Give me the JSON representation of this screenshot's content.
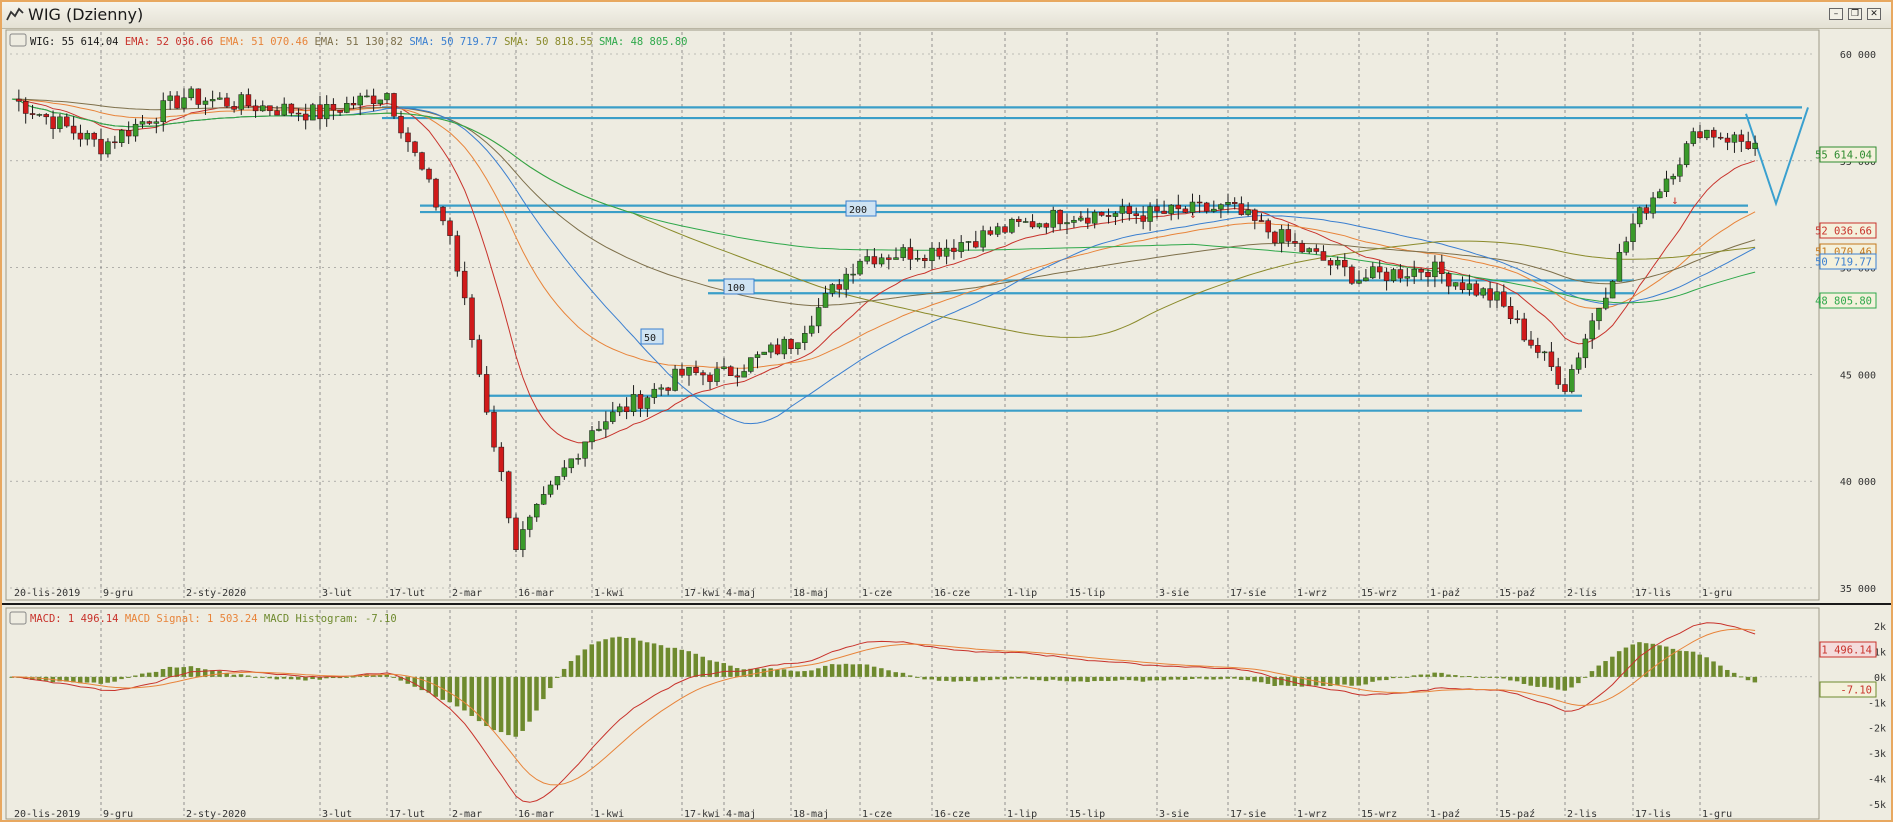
{
  "window": {
    "title": "WIG (Dzienny)",
    "buttons": [
      "minimize",
      "restore",
      "close"
    ]
  },
  "legend_main": [
    {
      "text": "WIG: 55 614.04",
      "color": "#1a1a1a"
    },
    {
      "text": "EMA: 52 036.66",
      "color": "#c8322b"
    },
    {
      "text": "EMA: 51 070.46",
      "color": "#e8843a"
    },
    {
      "text": "EMA: 51 130.82",
      "color": "#7d6f4a"
    },
    {
      "text": "SMA: 50 719.77",
      "color": "#3a7fd0"
    },
    {
      "text": "SMA: 50 818.55",
      "color": "#8a8a2a"
    },
    {
      "text": "SMA: 48 805.80",
      "color": "#2ea84a"
    }
  ],
  "legend_macd": [
    {
      "text": "MACD: 1 496.14",
      "color": "#c8322b"
    },
    {
      "text": "MACD Signal: 1 503.24",
      "color": "#e8843a"
    },
    {
      "text": "MACD Histogram: -7.10",
      "color": "#6e8a2e"
    }
  ],
  "price_axis": [
    "60 000",
    "55 000",
    "50 000",
    "45 000",
    "40 000",
    "35 000"
  ],
  "macd_axis": [
    "2k",
    "1k",
    "0k",
    "-1k",
    "-2k",
    "-3k",
    "-4k",
    "-5k"
  ],
  "date_labels": [
    "20-lis-2019",
    "9-gru",
    "2-sty-2020",
    "3-lut",
    "17-lut",
    "2-mar",
    "16-mar",
    "1-kwi",
    "17-kwi",
    "4-maj",
    "18-maj",
    "1-cze",
    "16-cze",
    "1-lip",
    "15-lip",
    "3-sie",
    "17-sie",
    "1-wrz",
    "15-wrz",
    "1-paź",
    "15-paź",
    "2-lis",
    "17-lis",
    "1-gru"
  ],
  "value_boxes": [
    {
      "text": "55 614.04",
      "color": "#2e8b2e",
      "border": "#2e8b2e",
      "bg": "#f4f1dc"
    },
    {
      "text": "52 036.66",
      "color": "#c8322b",
      "border": "#c8322b",
      "bg": "#f4f1dc"
    },
    {
      "text": "51 070.46",
      "color": "#c4781c",
      "border": "#c4781c",
      "bg": "#f4f1dc"
    },
    {
      "text": "50 719.77",
      "color": "#3a7fd0",
      "border": "#3a7fd0",
      "bg": "#f4f1dc"
    },
    {
      "text": "48 805.80",
      "color": "#2ea84a",
      "border": "#2ea84a",
      "bg": "#f4f1dc"
    },
    {
      "text": "1 496.14",
      "color": "#c8322b",
      "border": "#c8322b",
      "bg": "#f4dcdc"
    },
    {
      "text": "-7.10",
      "color": "#c8322b",
      "border": "#6e8a2e",
      "bg": "#f4f1dc"
    }
  ],
  "ma_tags": [
    "200",
    "100",
    "50"
  ],
  "chart_data": [
    {
      "type": "candlestick",
      "title": "WIG (Dzienny)",
      "ylim": [
        35000,
        60000
      ],
      "grid": true,
      "approx_close_path": [
        {
          "date": "20-lis-2019",
          "close": 57900
        },
        {
          "date": "9-gru",
          "close": 55700
        },
        {
          "date": "2-sty-2020",
          "close": 58000
        },
        {
          "date": "3-lut",
          "close": 57200
        },
        {
          "date": "17-lut",
          "close": 58200
        },
        {
          "date": "2-mar",
          "close": 51500
        },
        {
          "date": "16-mar",
          "close": 37000
        },
        {
          "date": "1-kwi",
          "close": 42500
        },
        {
          "date": "17-kwi",
          "close": 45000
        },
        {
          "date": "4-maj",
          "close": 45000
        },
        {
          "date": "18-maj",
          "close": 46500
        },
        {
          "date": "1-cze",
          "close": 50500
        },
        {
          "date": "16-cze",
          "close": 50800
        },
        {
          "date": "1-lip",
          "close": 51800
        },
        {
          "date": "15-lip",
          "close": 52500
        },
        {
          "date": "3-sie",
          "close": 52500
        },
        {
          "date": "17-sie",
          "close": 52800
        },
        {
          "date": "1-wrz",
          "close": 51000
        },
        {
          "date": "15-wrz",
          "close": 49500
        },
        {
          "date": "1-paź",
          "close": 50000
        },
        {
          "date": "15-paź",
          "close": 48500
        },
        {
          "date": "2-lis",
          "close": 44500
        },
        {
          "date": "17-lis",
          "close": 52000
        },
        {
          "date": "1-gru",
          "close": 56500
        }
      ],
      "indicators": [
        {
          "name": "EMA",
          "last": 52036.66
        },
        {
          "name": "EMA",
          "last": 51070.46
        },
        {
          "name": "EMA",
          "last": 51130.82
        },
        {
          "name": "SMA",
          "last": 50719.77
        },
        {
          "name": "SMA",
          "last": 50818.55
        },
        {
          "name": "SMA",
          "last": 48805.8
        }
      ],
      "horizontal_levels": [
        57500,
        57000,
        52900,
        52600,
        49400,
        48800,
        44000,
        43300
      ],
      "last": 55614.04
    },
    {
      "type": "line",
      "ylim": [
        -5000,
        2000
      ],
      "series": [
        {
          "name": "MACD",
          "last": 1496.14
        },
        {
          "name": "MACD Signal",
          "last": 1503.24
        },
        {
          "name": "MACD Histogram",
          "last": -7.1
        }
      ]
    }
  ]
}
